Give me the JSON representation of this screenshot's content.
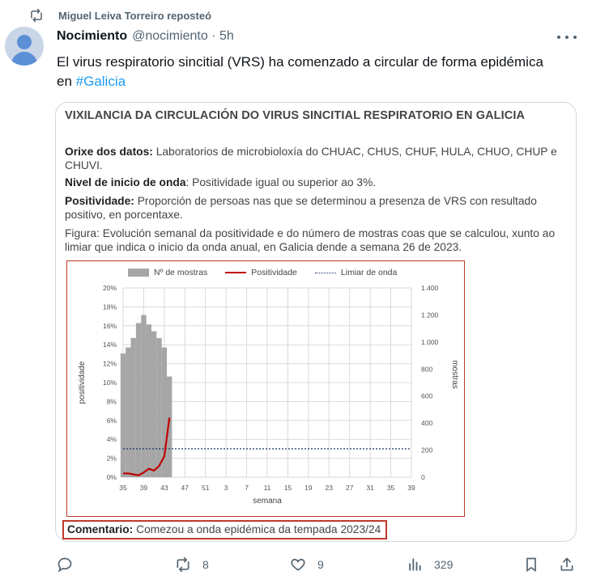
{
  "repost": {
    "text": "Miguel Leiva Torreiro reposteó"
  },
  "author": {
    "name": "Nocimiento",
    "meta": "@nocimiento · 5h"
  },
  "tweet": {
    "text": "El virus respiratorio sincitial (VRS) ha comenzado a circular de forma epidémica en ",
    "hashtag": "#Galicia"
  },
  "card": {
    "title": "VIXILANCIA DA CIRCULACIÓN DO VIRUS SINCITIAL RESPIRATORIO EN GALICIA",
    "orixe_label": "Orixe dos datos:",
    "orixe_text": " Laboratorios de microbioloxía do CHUAC, CHUS, CHUF, HULA, CHUO, CHUP e CHUVI.",
    "nivel_label": "Nivel de inicio de onda",
    "nivel_text": ": Positividade igual ou superior ao 3%.",
    "positividade_label": "Positividade:",
    "positividade_text": " Proporción de persoas nas que se determinou a presenza de VRS con resultado positivo, en porcentaxe.",
    "figura_text": "Figura: Evolución semanal da positividade e do número de mostras coas que se calculou, xunto ao limiar que indica o inicio da onda anual, en Galicia dende a semana 26 de 2023.",
    "comment_label": "Comentario:",
    "comment_text": " Comezou a onda epidémica da tempada 2023/24"
  },
  "chart_data": {
    "type": "bar",
    "xlabel": "semana",
    "ylabel": "positividade",
    "ylabel_right": "mostras",
    "x_ticks": [
      "35",
      "39",
      "43",
      "47",
      "51",
      "3",
      "7",
      "11",
      "15",
      "19",
      "23",
      "27",
      "31",
      "35",
      "39"
    ],
    "y_ticks": [
      "0%",
      "2%",
      "4%",
      "6%",
      "8%",
      "10%",
      "12%",
      "14%",
      "16%",
      "18%",
      "20%"
    ],
    "y2_ticks": [
      "0",
      "200",
      "400",
      "600",
      "800",
      "1.000",
      "1.200",
      "1.400"
    ],
    "ylim": [
      0,
      20
    ],
    "y2lim": [
      0,
      1400
    ],
    "legend_placement": "top",
    "series": [
      {
        "name": "Nº de mostras",
        "type": "bar",
        "axis": "right",
        "color": "#a6a6a6",
        "x_index": [
          0,
          1,
          2,
          3,
          4,
          5,
          6,
          7,
          8,
          9
        ],
        "values": [
          915,
          960,
          1030,
          1140,
          1200,
          1130,
          1080,
          1030,
          960,
          745
        ]
      },
      {
        "name": "Positividade",
        "type": "line",
        "axis": "left",
        "color": "#c00000",
        "x_index": [
          0,
          1,
          2,
          3,
          4,
          5,
          6,
          7,
          8,
          9
        ],
        "values": [
          0.4,
          0.4,
          0.3,
          0.2,
          0.5,
          0.9,
          0.7,
          1.2,
          2.2,
          6.3
        ]
      },
      {
        "name": "Limiar de onda",
        "type": "dotted",
        "axis": "left",
        "color": "#1f3864",
        "value": 3
      }
    ]
  },
  "actions": {
    "replies": "",
    "reposts": "8",
    "likes": "9",
    "views": "329"
  }
}
